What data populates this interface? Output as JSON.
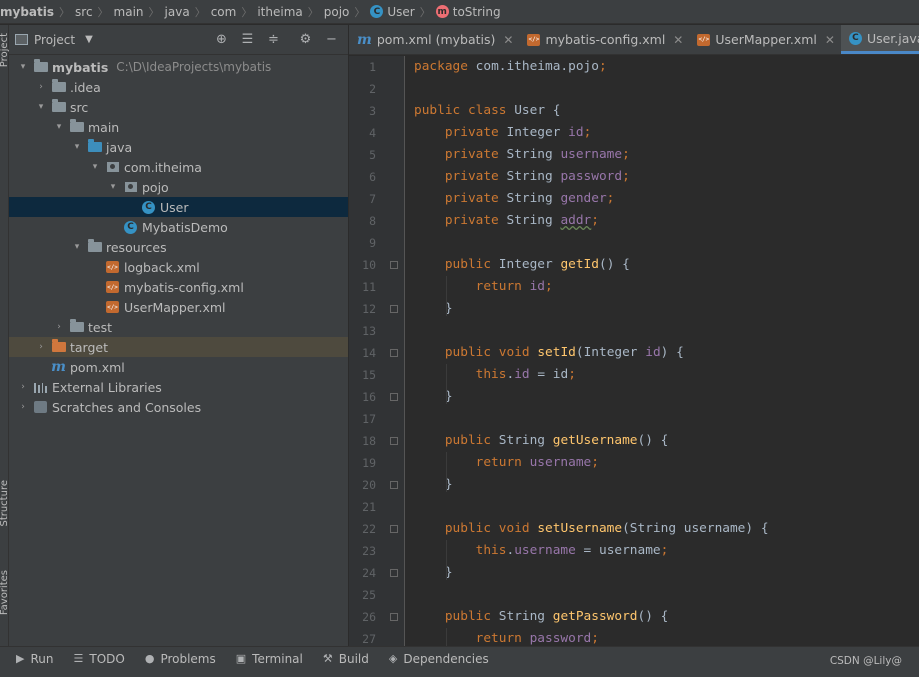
{
  "breadcrumb": {
    "items": [
      "mybatis",
      "src",
      "main",
      "java",
      "com",
      "itheima",
      "pojo",
      "User",
      "toString"
    ]
  },
  "side_stripe": {
    "project": "Project",
    "structure": "Structure",
    "favorites": "Favorites"
  },
  "project_panel": {
    "title": "Project",
    "tree": {
      "root": "mybatis",
      "root_path": "C:\\D\\IdeaProjects\\mybatis",
      "idea": ".idea",
      "src": "src",
      "main": "main",
      "java": "java",
      "com_itheima": "com.itheima",
      "pojo": "pojo",
      "user": "User",
      "mybatis_demo": "MybatisDemo",
      "resources": "resources",
      "logback": "logback.xml",
      "mybatis_config": "mybatis-config.xml",
      "user_mapper": "UserMapper.xml",
      "test": "test",
      "target": "target",
      "pom": "pom.xml",
      "external_libraries": "External Libraries",
      "scratches": "Scratches and Consoles"
    }
  },
  "tabs": [
    {
      "label": "pom.xml (mybatis)",
      "icon": "maven-icon",
      "active": false
    },
    {
      "label": "mybatis-config.xml",
      "icon": "xml-icon",
      "active": false
    },
    {
      "label": "UserMapper.xml",
      "icon": "xml-icon",
      "active": false
    },
    {
      "label": "User.java",
      "icon": "class-icon",
      "active": true
    }
  ],
  "editor": {
    "line_numbers": [
      "1",
      "2",
      "3",
      "4",
      "5",
      "6",
      "7",
      "8",
      "9",
      "10",
      "11",
      "12",
      "13",
      "14",
      "15",
      "16",
      "17",
      "18",
      "19",
      "20",
      "21",
      "22",
      "23",
      "24",
      "25",
      "26",
      "27"
    ],
    "fold_lines": [
      "10",
      "12",
      "14",
      "16",
      "18",
      "20",
      "22",
      "24",
      "26"
    ],
    "lines": [
      "package com.itheima.pojo;",
      "",
      "public class User {",
      "    private Integer id;",
      "    private String username;",
      "    private String password;",
      "    private String gender;",
      "    private String addr;",
      "",
      "    public Integer getId() {",
      "        return id;",
      "    }",
      "",
      "    public void setId(Integer id) {",
      "        this.id = id;",
      "    }",
      "",
      "    public String getUsername() {",
      "        return username;",
      "    }",
      "",
      "    public void setUsername(String username) {",
      "        this.username = username;",
      "    }",
      "",
      "    public String getPassword() {",
      "        return password;"
    ]
  },
  "bottom_tools": [
    {
      "label": "Run",
      "icon": "run-icon"
    },
    {
      "label": "TODO",
      "icon": "todo-icon"
    },
    {
      "label": "Problems",
      "icon": "problems-icon"
    },
    {
      "label": "Terminal",
      "icon": "terminal-icon"
    },
    {
      "label": "Build",
      "icon": "build-icon"
    },
    {
      "label": "Dependencies",
      "icon": "dependencies-icon"
    }
  ],
  "watermark": "CSDN @Lily@",
  "colors": {
    "keyword": "#cc7832",
    "field": "#9876aa",
    "method": "#ffc66d",
    "text": "#a9b7c6",
    "selection": "#0d293e",
    "active_tab_underline": "#4a88c7"
  }
}
